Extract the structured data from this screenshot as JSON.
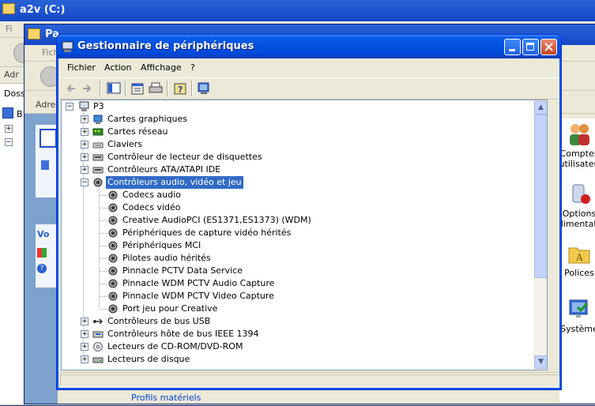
{
  "window_back1": {
    "title": "a2v (C:)",
    "menu_first": "Fi",
    "addr_label": "Adr",
    "side_text": "Doss",
    "side_b": "B"
  },
  "window_back2": {
    "title": "Pa",
    "menu_first": "Fich",
    "addr_label": "Adres",
    "panel_heading": "Vo"
  },
  "control_panel": {
    "items": [
      {
        "label_1": "Comptes",
        "label_2": "utilisateu",
        "icon": "users-icon"
      },
      {
        "label_1": "Options",
        "label_2": "alimentatio",
        "icon": "power-options-icon"
      },
      {
        "label_1": "Polices",
        "label_2": "",
        "icon": "fonts-folder-icon"
      },
      {
        "label_1": "Système",
        "label_2": "",
        "icon": "system-icon"
      }
    ],
    "bottom_tab": "Profils matériels"
  },
  "dialog": {
    "title": "Gestionnaire de périphériques",
    "menu": [
      "Fichier",
      "Action",
      "Affichage",
      "?"
    ],
    "toolbar": [
      "back-arrow-icon",
      "forward-arrow-icon",
      "console-tree-icon",
      "properties-icon",
      "print-icon",
      "help-icon",
      "scan-hardware-icon"
    ]
  },
  "tree": {
    "root": "P3",
    "categories": [
      {
        "label": "Cartes graphiques",
        "icon": "display-adapter-icon",
        "expanded": false
      },
      {
        "label": "Cartes réseau",
        "icon": "network-card-icon",
        "expanded": false
      },
      {
        "label": "Claviers",
        "icon": "keyboard-icon",
        "expanded": false
      },
      {
        "label": "Contrôleur de lecteur de disquettes",
        "icon": "floppy-controller-icon",
        "expanded": false
      },
      {
        "label": "Contrôleurs ATA/ATAPI IDE",
        "icon": "ide-controller-icon",
        "expanded": false
      },
      {
        "label": "Contrôleurs audio, vidéo et jeu",
        "icon": "audio-icon",
        "expanded": true,
        "selected": true,
        "children": [
          "Codecs audio",
          "Codecs vidéo",
          "Creative AudioPCI (ES1371,ES1373) (WDM)",
          "Périphériques de capture vidéo hérités",
          "Périphériques MCI",
          "Pilotes audio hérités",
          "Pinnacle PCTV Data Service",
          "Pinnacle WDM PCTV Audio Capture",
          "Pinnacle WDM PCTV Video Capture",
          "Port jeu pour Creative"
        ]
      },
      {
        "label": "Contrôleurs de bus USB",
        "icon": "usb-icon",
        "expanded": false
      },
      {
        "label": "Contrôleurs hôte de bus IEEE 1394",
        "icon": "ieee1394-icon",
        "expanded": false
      },
      {
        "label": "Lecteurs de CD-ROM/DVD-ROM",
        "icon": "cdrom-icon",
        "expanded": false
      },
      {
        "label": "Lecteurs de disque",
        "icon": "disk-drive-icon",
        "expanded": false
      }
    ]
  },
  "colors": {
    "selection": "#316ac5",
    "titlebar": "#0350df"
  }
}
